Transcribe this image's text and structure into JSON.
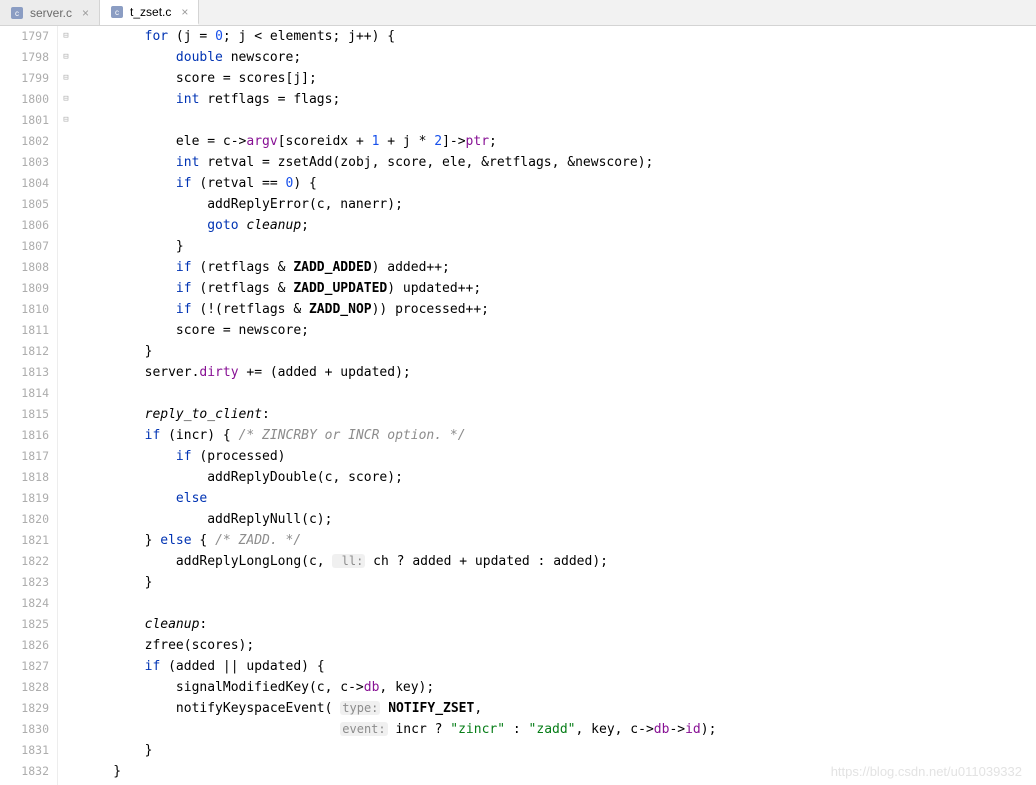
{
  "tabs": [
    {
      "name": "server.c",
      "active": false
    },
    {
      "name": "t_zset.c",
      "active": true
    }
  ],
  "lineStart": 1797,
  "lineEnd": 1832,
  "folds": {
    "1797": "⊟",
    "1804": "⊟",
    "1812": "⊟",
    "1816": "⊟",
    "1821": "⊟"
  },
  "code": [
    {
      "n": 1797,
      "html": "        <span class='kw'>for</span> (j = <span class='num'>0</span>; j &lt; elements; j++) {"
    },
    {
      "n": 1798,
      "html": "            <span class='kw'>double</span> newscore;"
    },
    {
      "n": 1799,
      "html": "            score = scores[j];"
    },
    {
      "n": 1800,
      "html": "            <span class='kw'>int</span> retflags = flags;"
    },
    {
      "n": 1801,
      "html": ""
    },
    {
      "n": 1802,
      "html": "            ele = c-&gt;<span class='field'>argv</span>[scoreidx + <span class='num'>1</span> + j * <span class='num'>2</span>]-&gt;<span class='field'>ptr</span>;"
    },
    {
      "n": 1803,
      "html": "            <span class='kw'>int</span> retval = zsetAdd(zobj, score, ele, &amp;retflags, &amp;newscore);"
    },
    {
      "n": 1804,
      "html": "            <span class='kw'>if</span> (retval == <span class='num'>0</span>) {"
    },
    {
      "n": 1805,
      "html": "                addReplyError(c, nanerr);"
    },
    {
      "n": 1806,
      "html": "                <span class='kw'>goto</span> <span class='lbl'>cleanup</span>;"
    },
    {
      "n": 1807,
      "html": "            }"
    },
    {
      "n": 1808,
      "html": "            <span class='kw'>if</span> (retflags &amp; <span class='bold'>ZADD_ADDED</span>) added++;"
    },
    {
      "n": 1809,
      "html": "            <span class='kw'>if</span> (retflags &amp; <span class='bold'>ZADD_UPDATED</span>) updated++;"
    },
    {
      "n": 1810,
      "html": "            <span class='kw'>if</span> (!(retflags &amp; <span class='bold'>ZADD_NOP</span>)) processed++;"
    },
    {
      "n": 1811,
      "html": "            score = newscore;"
    },
    {
      "n": 1812,
      "html": "        }"
    },
    {
      "n": 1813,
      "html": "        server.<span class='field'>dirty</span> += (added + updated);"
    },
    {
      "n": 1814,
      "html": ""
    },
    {
      "n": 1815,
      "html": "        <span class='lbl'>reply_to_client</span>:"
    },
    {
      "n": 1816,
      "html": "        <span class='kw'>if</span> (incr) { <span class='cmt'>/* ZINCRBY or INCR option. */</span>"
    },
    {
      "n": 1817,
      "html": "            <span class='kw'>if</span> (processed)"
    },
    {
      "n": 1818,
      "html": "                addReplyDouble(c, score);"
    },
    {
      "n": 1819,
      "html": "            <span class='kw'>else</span>"
    },
    {
      "n": 1820,
      "html": "                addReplyNull(c);"
    },
    {
      "n": 1821,
      "html": "        } <span class='kw'>else</span> { <span class='cmt'>/* ZADD. */</span>"
    },
    {
      "n": 1822,
      "html": "            addReplyLongLong(c, <span class='hint'> ll:</span> ch ? added + updated : added);"
    },
    {
      "n": 1823,
      "html": "        }"
    },
    {
      "n": 1824,
      "html": ""
    },
    {
      "n": 1825,
      "html": "        <span class='lbl'>cleanup</span>:"
    },
    {
      "n": 1826,
      "html": "        zfree(scores);"
    },
    {
      "n": 1827,
      "html": "        <span class='kw'>if</span> (added || updated) {"
    },
    {
      "n": 1828,
      "html": "            signalModifiedKey(c, c-&gt;<span class='field'>db</span>, key);"
    },
    {
      "n": 1829,
      "html": "            notifyKeyspaceEvent( <span class='hint'>type:</span> <span class='bold'>NOTIFY_ZSET</span>,"
    },
    {
      "n": 1830,
      "html": "                                 <span class='hint'>event:</span> incr ? <span class='str'>\"zincr\"</span> : <span class='str'>\"zadd\"</span>, key, c-&gt;<span class='field'>db</span>-&gt;<span class='field'>id</span>);"
    },
    {
      "n": 1831,
      "html": "        }"
    },
    {
      "n": 1832,
      "html": "    }"
    }
  ],
  "watermark": "https://blog.csdn.net/u011039332"
}
